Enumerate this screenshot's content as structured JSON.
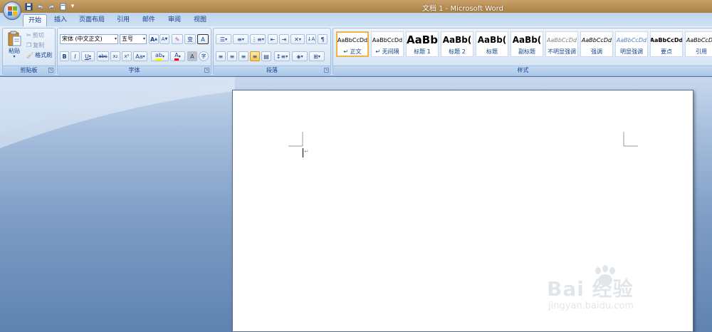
{
  "window": {
    "title": "文档 1 - Microsoft Word"
  },
  "tabs": [
    {
      "label": "开始"
    },
    {
      "label": "插入"
    },
    {
      "label": "页面布局"
    },
    {
      "label": "引用"
    },
    {
      "label": "邮件"
    },
    {
      "label": "审阅"
    },
    {
      "label": "视图"
    }
  ],
  "clipboard": {
    "group_label": "剪贴板",
    "paste_label": "粘贴",
    "cut_label": "剪切",
    "copy_label": "复制",
    "format_painter_label": "格式刷"
  },
  "font": {
    "group_label": "字体",
    "font_name": "宋体 (中文正文)",
    "font_size": "五号",
    "grow_label": "A",
    "shrink_label": "A",
    "bold": "B",
    "italic": "I",
    "underline": "U",
    "strike": "abc",
    "subscript": "x₂",
    "superscript": "x²",
    "change_case": "Aa",
    "font_color": "A",
    "char_shading": "A",
    "phonetic": "变",
    "char_border": "A",
    "enclose": "字"
  },
  "paragraph": {
    "group_label": "段落"
  },
  "styles": {
    "group_label": "样式",
    "items": [
      {
        "sample": "AaBbCcDd",
        "name": "↵ 正文"
      },
      {
        "sample": "AaBbCcDd",
        "name": "↵ 无间隔"
      },
      {
        "sample": "AaBb",
        "name": "标题 1"
      },
      {
        "sample": "AaBb(",
        "name": "标题 2"
      },
      {
        "sample": "AaBb(",
        "name": "标题"
      },
      {
        "sample": "AaBb(",
        "name": "副标题"
      },
      {
        "sample": "AaBbCcDd",
        "name": "不明显强调"
      },
      {
        "sample": "AaBbCcDd",
        "name": "强调"
      },
      {
        "sample": "AaBbCcDd",
        "name": "明显强调"
      },
      {
        "sample": "AaBbCcDd",
        "name": "要点"
      },
      {
        "sample": "AaBbCcDd",
        "name": "引用"
      }
    ]
  },
  "document": {
    "paragraph_mark": "↵"
  },
  "watermark": {
    "main": "Bai 经验",
    "sub": "jingyan.baidu.com"
  },
  "colors": {
    "highlight": "#ffff00",
    "font_color": "#ff0000",
    "selected_style": "#f0b445"
  }
}
